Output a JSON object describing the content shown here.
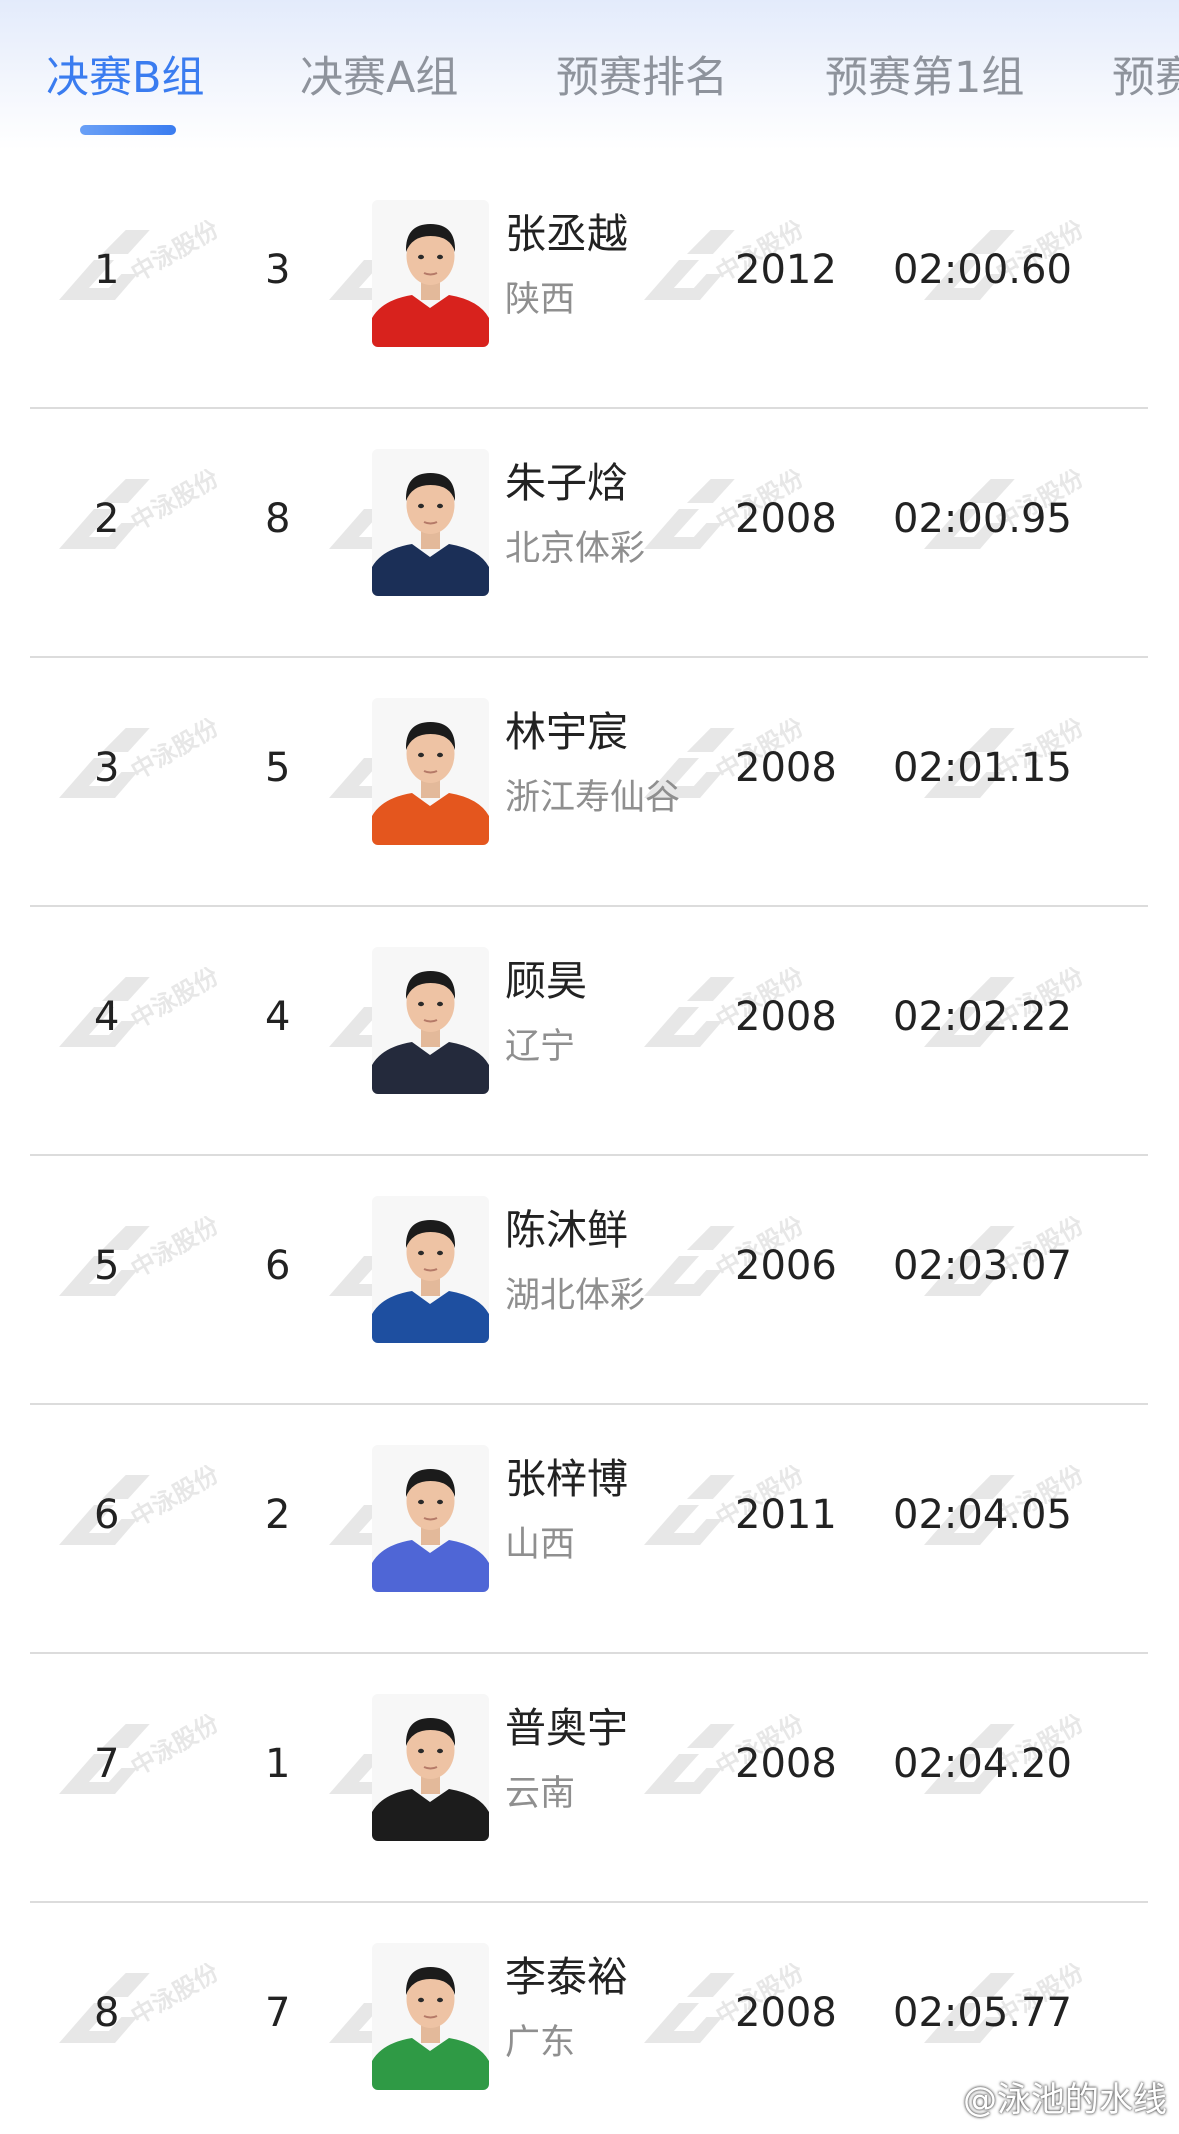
{
  "tabs": [
    {
      "label": "决赛B组",
      "active": true
    },
    {
      "label": "决赛A组",
      "active": false
    },
    {
      "label": "预赛排名",
      "active": false
    },
    {
      "label": "预赛第1组",
      "active": false
    },
    {
      "label": "预赛",
      "active": false
    }
  ],
  "results": [
    {
      "rank": "1",
      "lane": "3",
      "name": "张丞越",
      "team": "陕西",
      "year": "2012",
      "time": "02:00.60",
      "jersey_color": "#d8221d"
    },
    {
      "rank": "2",
      "lane": "8",
      "name": "朱子焓",
      "team": "北京体彩",
      "year": "2008",
      "time": "02:00.95",
      "jersey_color": "#1b2f57"
    },
    {
      "rank": "3",
      "lane": "5",
      "name": "林宇宸",
      "team": "浙江寿仙谷",
      "year": "2008",
      "time": "02:01.15",
      "jersey_color": "#e4561e"
    },
    {
      "rank": "4",
      "lane": "4",
      "name": "顾昊",
      "team": "辽宁",
      "year": "2008",
      "time": "02:02.22",
      "jersey_color": "#242a3c"
    },
    {
      "rank": "5",
      "lane": "6",
      "name": "陈沐鲜",
      "team": "湖北体彩",
      "year": "2006",
      "time": "02:03.07",
      "jersey_color": "#1e4fa0"
    },
    {
      "rank": "6",
      "lane": "2",
      "name": "张梓博",
      "team": "山西",
      "year": "2011",
      "time": "02:04.05",
      "jersey_color": "#4f66d6"
    },
    {
      "rank": "7",
      "lane": "1",
      "name": "普奥宇",
      "team": "云南",
      "year": "2008",
      "time": "02:04.20",
      "jersey_color": "#1c1c1c"
    },
    {
      "rank": "8",
      "lane": "7",
      "name": "李泰裕",
      "team": "广东",
      "year": "2008",
      "time": "02:05.77",
      "jersey_color": "#2f9a45"
    }
  ],
  "watermark": {
    "text": "中泳股份"
  },
  "credit": {
    "text": "@泳池的水线",
    "icon": "weibo-icon"
  },
  "theme": {
    "accent": "#3a7cf0",
    "tab_inactive": "#8e939c",
    "divider": "#dcdcdc",
    "secondary_text": "#8f8f8f"
  }
}
